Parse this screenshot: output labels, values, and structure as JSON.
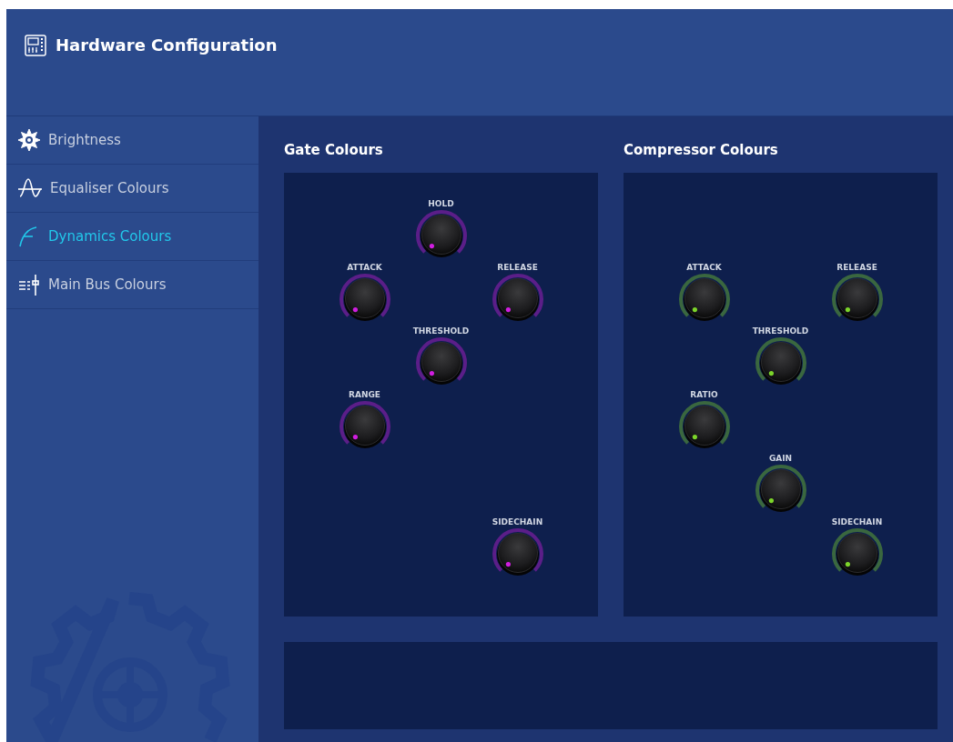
{
  "header": {
    "title": "Hardware Configuration"
  },
  "sidebar": {
    "items": [
      {
        "label": "Brightness",
        "kind": "brightness",
        "selected": false
      },
      {
        "label": "Equaliser Colours",
        "kind": "equaliser",
        "selected": false
      },
      {
        "label": "Dynamics Colours",
        "kind": "dynamics",
        "selected": true
      },
      {
        "label": "Main Bus Colours",
        "kind": "bus",
        "selected": false
      }
    ]
  },
  "panels": [
    {
      "title": "Gate Colours",
      "color": "#d01ee0",
      "knobs": [
        {
          "label": "HOLD"
        },
        {
          "label": "ATTACK"
        },
        {
          "label": "RELEASE"
        },
        {
          "label": "THRESHOLD"
        },
        {
          "label": "RANGE"
        },
        {
          "label": "SIDECHAIN"
        }
      ]
    },
    {
      "title": "Compressor Colours",
      "color": "#7cd42a",
      "knobs": [
        {
          "label": "ATTACK"
        },
        {
          "label": "RELEASE"
        },
        {
          "label": "THRESHOLD"
        },
        {
          "label": "RATIO"
        },
        {
          "label": "GAIN"
        },
        {
          "label": "SIDECHAIN"
        }
      ]
    }
  ]
}
